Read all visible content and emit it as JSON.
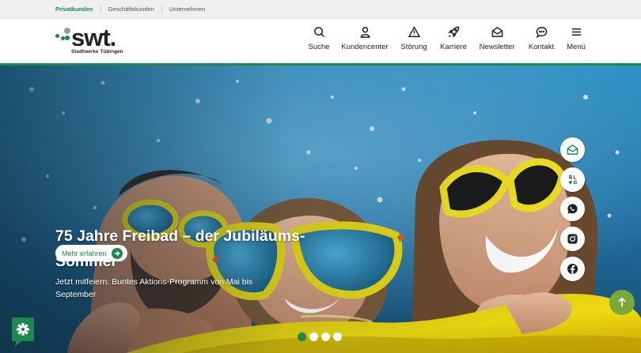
{
  "topbar": {
    "links": [
      {
        "label": "Privatkunden",
        "active": true
      },
      {
        "label": "Geschäftskunden",
        "active": false
      },
      {
        "label": "Unternehmen",
        "active": false
      }
    ]
  },
  "logo": {
    "word": "swt.",
    "subtitle": "Stadtwerke Tübingen"
  },
  "nav": [
    {
      "label": "Suche",
      "icon": "search-icon"
    },
    {
      "label": "Kundencenter",
      "icon": "user-icon"
    },
    {
      "label": "Störung",
      "icon": "warning-icon"
    },
    {
      "label": "Karriere",
      "icon": "rocket-icon"
    },
    {
      "label": "Newsletter",
      "icon": "envelope-icon"
    },
    {
      "label": "Kontakt",
      "icon": "chat-icon"
    },
    {
      "label": "Menü",
      "icon": "hamburger-icon"
    }
  ],
  "hero": {
    "title": "75 Jahre Freibad – der Jubiläums-Sommer",
    "subtitle": "Jetzt mitfeiern: Buntes Aktions-Programm von Mai bis September",
    "button": "Mehr erfahren",
    "slides": 4,
    "active_slide": 1
  },
  "social": [
    {
      "name": "newsletter-icon"
    },
    {
      "name": "blog-icon",
      "label": "BLOG"
    },
    {
      "name": "whatsapp-icon"
    },
    {
      "name": "instagram-icon"
    },
    {
      "name": "facebook-icon"
    }
  ],
  "colors": {
    "brand_green": "#1b8a4f",
    "scroll_top": "#7aa83a",
    "logo_grey": "#9a9a9a"
  }
}
